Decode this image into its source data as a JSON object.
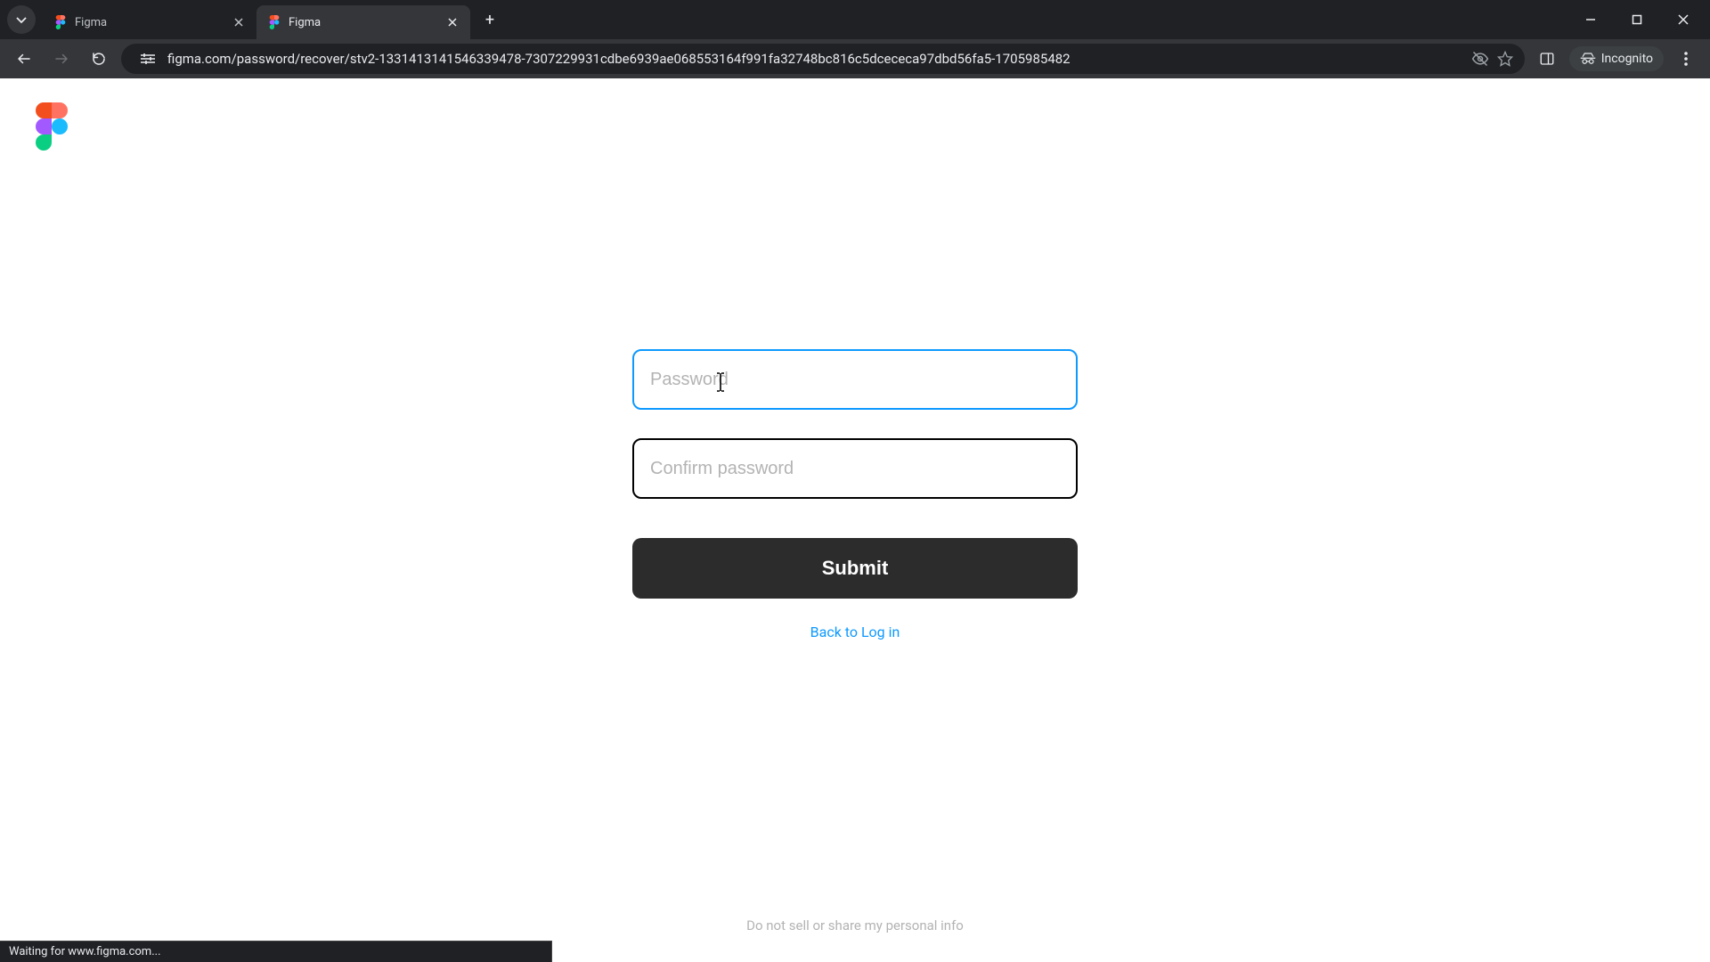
{
  "browser": {
    "tabs": [
      {
        "title": "Figma",
        "active": false
      },
      {
        "title": "Figma",
        "active": true
      }
    ],
    "url": "figma.com/password/recover/stv2-1331413141546339478-7307229931cdbe6939ae068553164f991fa32748bc816c5dcececa97dbd56fa5-1705985482",
    "incognito_label": "Incognito",
    "status_text": "Waiting for www.figma.com..."
  },
  "form": {
    "password_placeholder": "Password",
    "password_value": "",
    "confirm_placeholder": "Confirm password",
    "confirm_value": "",
    "submit_label": "Submit",
    "back_link": "Back to Log in"
  },
  "footer": {
    "privacy_link": "Do not sell or share my personal info"
  }
}
